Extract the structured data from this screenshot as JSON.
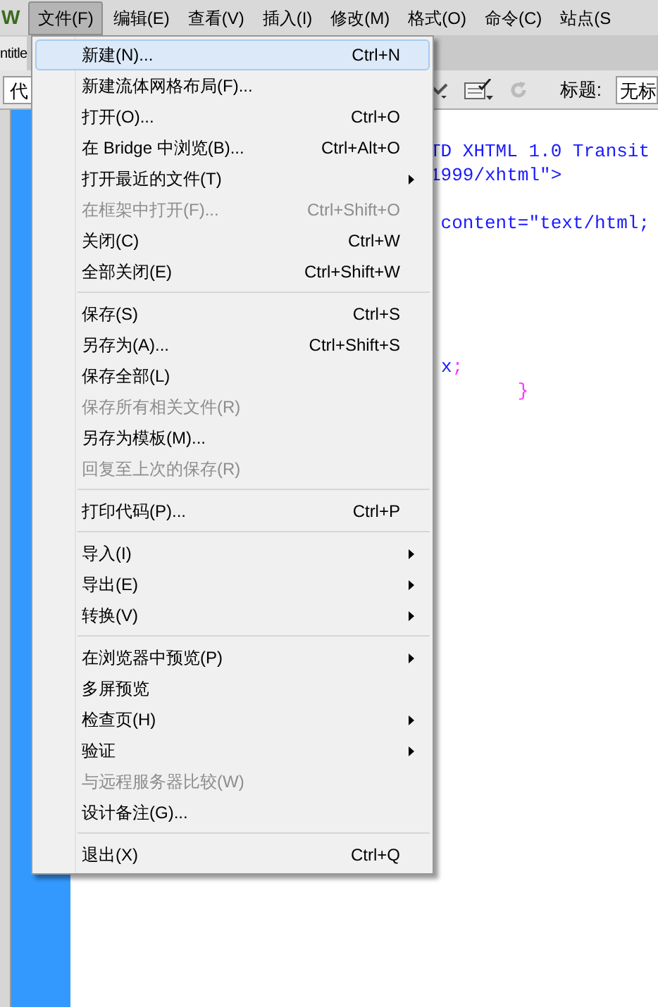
{
  "menubar": {
    "logo": "W",
    "items": [
      {
        "label": "文件(F)",
        "selected": true
      },
      {
        "label": "编辑(E)",
        "selected": false
      },
      {
        "label": "查看(V)",
        "selected": false
      },
      {
        "label": "插入(I)",
        "selected": false
      },
      {
        "label": "修改(M)",
        "selected": false
      },
      {
        "label": "格式(O)",
        "selected": false
      },
      {
        "label": "命令(C)",
        "selected": false
      },
      {
        "label": "站点(S",
        "selected": false
      }
    ]
  },
  "document_tab": "ntitle",
  "toolbar": {
    "view_button": "代",
    "title_label": "标题:",
    "title_value": "无标"
  },
  "code_lines": [
    {
      "kind": "blank"
    },
    {
      "kind": "blue",
      "text": "TD XHTML 1.0 Transit"
    },
    {
      "kind": "blue",
      "text": "1999/xhtml\">"
    },
    {
      "kind": "blank"
    },
    {
      "kind": "blue",
      "text": " content=\"text/html;"
    },
    {
      "kind": "blank"
    },
    {
      "kind": "blank"
    },
    {
      "kind": "blank"
    },
    {
      "kind": "blank"
    },
    {
      "kind": "blank"
    },
    {
      "kind": "mixed",
      "text": "x",
      "tail": ";"
    },
    {
      "kind": "magenta",
      "text": "        }"
    }
  ],
  "file_menu": [
    {
      "kind": "item",
      "label": "新建(N)...",
      "shortcut": "Ctrl+N",
      "submenu": false,
      "disabled": false,
      "selected": true
    },
    {
      "kind": "item",
      "label": "新建流体网格布局(F)...",
      "submenu": false,
      "disabled": false,
      "selected": false
    },
    {
      "kind": "item",
      "label": "打开(O)...",
      "shortcut": "Ctrl+O",
      "submenu": false,
      "disabled": false,
      "selected": false
    },
    {
      "kind": "item",
      "label": "在 Bridge 中浏览(B)...",
      "shortcut": "Ctrl+Alt+O",
      "submenu": false,
      "disabled": false,
      "selected": false
    },
    {
      "kind": "item",
      "label": "打开最近的文件(T)",
      "submenu": true,
      "disabled": false,
      "selected": false
    },
    {
      "kind": "item",
      "label": "在框架中打开(F)...",
      "shortcut": "Ctrl+Shift+O",
      "submenu": false,
      "disabled": true,
      "selected": false
    },
    {
      "kind": "item",
      "label": "关闭(C)",
      "shortcut": "Ctrl+W",
      "submenu": false,
      "disabled": false,
      "selected": false
    },
    {
      "kind": "item",
      "label": "全部关闭(E)",
      "shortcut": "Ctrl+Shift+W",
      "submenu": false,
      "disabled": false,
      "selected": false
    },
    {
      "kind": "separator"
    },
    {
      "kind": "item",
      "label": "保存(S)",
      "shortcut": "Ctrl+S",
      "submenu": false,
      "disabled": false,
      "selected": false
    },
    {
      "kind": "item",
      "label": "另存为(A)...",
      "shortcut": "Ctrl+Shift+S",
      "submenu": false,
      "disabled": false,
      "selected": false
    },
    {
      "kind": "item",
      "label": "保存全部(L)",
      "submenu": false,
      "disabled": false,
      "selected": false
    },
    {
      "kind": "item",
      "label": "保存所有相关文件(R)",
      "submenu": false,
      "disabled": true,
      "selected": false
    },
    {
      "kind": "item",
      "label": "另存为模板(M)...",
      "submenu": false,
      "disabled": false,
      "selected": false
    },
    {
      "kind": "item",
      "label": "回复至上次的保存(R)",
      "submenu": false,
      "disabled": true,
      "selected": false
    },
    {
      "kind": "separator"
    },
    {
      "kind": "item",
      "label": "打印代码(P)...",
      "shortcut": "Ctrl+P",
      "submenu": false,
      "disabled": false,
      "selected": false
    },
    {
      "kind": "separator"
    },
    {
      "kind": "item",
      "label": "导入(I)",
      "submenu": true,
      "disabled": false,
      "selected": false
    },
    {
      "kind": "item",
      "label": "导出(E)",
      "submenu": true,
      "disabled": false,
      "selected": false
    },
    {
      "kind": "item",
      "label": "转换(V)",
      "submenu": true,
      "disabled": false,
      "selected": false
    },
    {
      "kind": "separator"
    },
    {
      "kind": "item",
      "label": "在浏览器中预览(P)",
      "submenu": true,
      "disabled": false,
      "selected": false
    },
    {
      "kind": "item",
      "label": "多屏预览",
      "submenu": false,
      "disabled": false,
      "selected": false
    },
    {
      "kind": "item",
      "label": "检查页(H)",
      "submenu": true,
      "disabled": false,
      "selected": false
    },
    {
      "kind": "item",
      "label": "验证",
      "submenu": true,
      "disabled": false,
      "selected": false
    },
    {
      "kind": "item",
      "label": "与远程服务器比较(W)",
      "submenu": false,
      "disabled": true,
      "selected": false
    },
    {
      "kind": "item",
      "label": "设计备注(G)...",
      "submenu": false,
      "disabled": false,
      "selected": false
    },
    {
      "kind": "separator"
    },
    {
      "kind": "item",
      "label": "退出(X)",
      "shortcut": "Ctrl+Q",
      "submenu": false,
      "disabled": false,
      "selected": false
    }
  ]
}
